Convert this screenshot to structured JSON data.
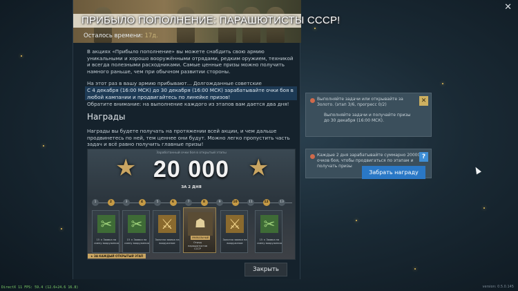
{
  "window": {
    "close_icon": "close-icon"
  },
  "event": {
    "title": "ПРИБЫЛО ПОПОЛНЕНИЕ: ПАРАШЮТИСТЫ СССР!",
    "timer_label": "Осталось времени:",
    "timer_value": "17д.",
    "intro": "В акциях «Прибыло пополнение» вы можете снабдить свою армию уникальными и хорошо вооружёнными отрядами, редким оружием, техникой и всегда полезными расходниками. Самые ценные призы можно получить намного раньше, чем при обычном развитии стороны.",
    "arrival": "На этот раз в вашу армию прибывают... Долгожданные советские парашютисты!",
    "highlight": "С 4 декабря (16:00 МСК) до 30 декабря (16:00 МСК) зарабатывайте очки боя в любой кампании и продвигайтесь по линейке призов!",
    "notice": "Обратите внимание: на выполнение каждого из этапов вам дается два дня!",
    "rewards_heading": "Награды",
    "rewards_text": "Награды вы будете получать на протяжении всей акции, и чем дальше продвинетесь по ней, тем ценнее они будут. Можно легко пропустить часть задач и всё равно получить главные призы!",
    "close_button": "Закрыть"
  },
  "rewards_image": {
    "caption": "Заработанный очки боя в открытый этапы",
    "score": "20 000",
    "score_sub": "ЗА 2 ДНЯ",
    "track_nodes": [
      "1",
      "2",
      "3",
      "4",
      "5",
      "6",
      "7",
      "8",
      "9",
      "10",
      "11",
      "12",
      "13"
    ],
    "cards": [
      {
        "caption": "15 × Заявка на смену вооружения",
        "kind": "green"
      },
      {
        "caption": "15 × Заявка на смену вооружения",
        "kind": "green"
      },
      {
        "caption": "Золотая заявка на вооружение",
        "kind": "gold"
      },
      {
        "caption": "Отряд парашютистов СССР",
        "kind": "featured",
        "badge": "УНИКАЛЬНЫЙ"
      },
      {
        "caption": "Золотая заявка на вооружение",
        "kind": "gold"
      },
      {
        "caption": "15 × Заявка на смену вооружения",
        "kind": "green"
      }
    ],
    "bottom_tag": "★ ЗА КАЖДЫЙ ОТКРЫТЫЙ ЭТАП"
  },
  "tasks": [
    {
      "text": "Выполняйте задачи или открывайте за Золото. (этап 3/6, прогресс 0/2)",
      "sub": "Выполняйте задачи и получайте призы\nдо 30 декабря (16:00 МСК).",
      "icon": "bell-icon"
    },
    {
      "text": "Каждые 2 дня зарабатывайте суммарно 20000 очков боя, чтобы продвигаться по этапам и получать призы",
      "icon": "help-icon",
      "button": "Забрать награду"
    }
  ],
  "footer": {
    "fps": "DirectX 11 FPS: 59.4 (12.6+24.6 16.8)",
    "version": "version: 0.5.0.145"
  },
  "colors": {
    "accent": "#2a78c6",
    "gold": "#c9a562",
    "panel": "#15222c"
  }
}
